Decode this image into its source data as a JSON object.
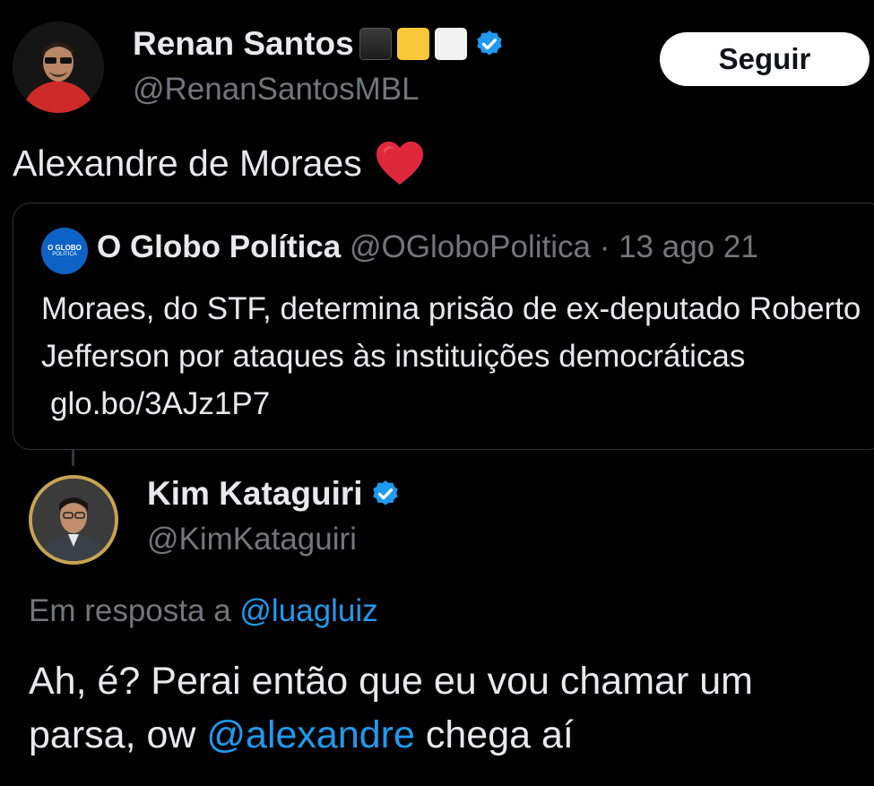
{
  "tweet1": {
    "display_name": "Renan Santos",
    "handle": "@RenanSantosMBL",
    "follow_label": "Seguir",
    "text": "Alexandre de Moraes",
    "emoji_flags": [
      "black-square",
      "yellow-square",
      "white-square"
    ],
    "verified_icon": "verified-badge-icon",
    "heart_icon": "red-heart-emoji"
  },
  "quote": {
    "avatar_text_top": "O GLOBO",
    "avatar_text_bottom": "POLÍTICA",
    "display_name": "O Globo Política",
    "handle": "@OGloboPolitica",
    "separator": "·",
    "date": "13 ago 21",
    "text": "Moraes, do STF, determina prisão de ex-deputado Roberto Jefferson por ataques às instituições democráticas",
    "link": "glo.bo/3AJz1P7"
  },
  "tweet2": {
    "display_name": "Kim Kataguiri",
    "handle": "@KimKataguiri",
    "reply_prefix": "Em resposta a",
    "reply_handle": "@luagluiz",
    "text_part1": "Ah, é? Perai então que eu vou chamar um parsa, ow",
    "mention": "@alexandre",
    "text_part2": "chega aí"
  },
  "colors": {
    "background": "#000000",
    "text": "#e7e9ea",
    "muted": "#71767b",
    "link": "#1d9bf0",
    "verified": "#1d9bf0",
    "heart": "#e0283c"
  }
}
